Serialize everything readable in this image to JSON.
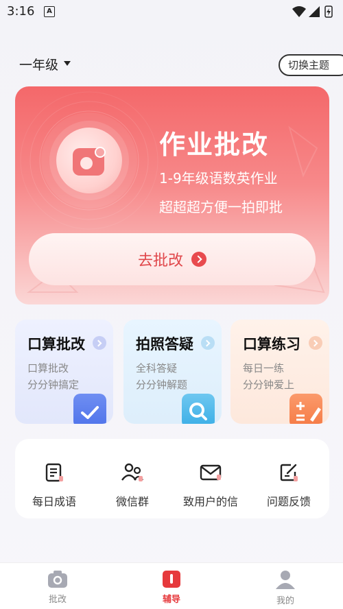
{
  "status_bar": {
    "time": "3:16",
    "app_badge": "A"
  },
  "grade": {
    "label": "一年级"
  },
  "theme_button": {
    "label": "切换主题"
  },
  "hero": {
    "title": "作业批改",
    "subtitle1": "1-9年级语数英作业",
    "subtitle2": "超超超方便一拍即批",
    "cta": "去批改"
  },
  "features": [
    {
      "title": "口算批改",
      "line1": "口算批改",
      "line2": "分分钟搞定"
    },
    {
      "title": "拍照答疑",
      "line1": "全科答疑",
      "line2": "分分钟解题"
    },
    {
      "title": "口算练习",
      "line1": "每日一练",
      "line2": "分分钟爱上"
    }
  ],
  "tools": [
    {
      "label": "每日成语",
      "icon": "document-icon"
    },
    {
      "label": "微信群",
      "icon": "people-icon"
    },
    {
      "label": "致用户的信",
      "icon": "mail-icon"
    },
    {
      "label": "问题反馈",
      "icon": "feedback-icon"
    }
  ],
  "nav": [
    {
      "label": "批改",
      "icon": "camera-icon"
    },
    {
      "label": "辅导",
      "icon": "tutor-icon"
    },
    {
      "label": "我的",
      "icon": "profile-icon"
    }
  ],
  "colors": {
    "accent": "#e6393c",
    "hero_top": "#f4686a",
    "hero_bottom": "#fbd7d6"
  }
}
